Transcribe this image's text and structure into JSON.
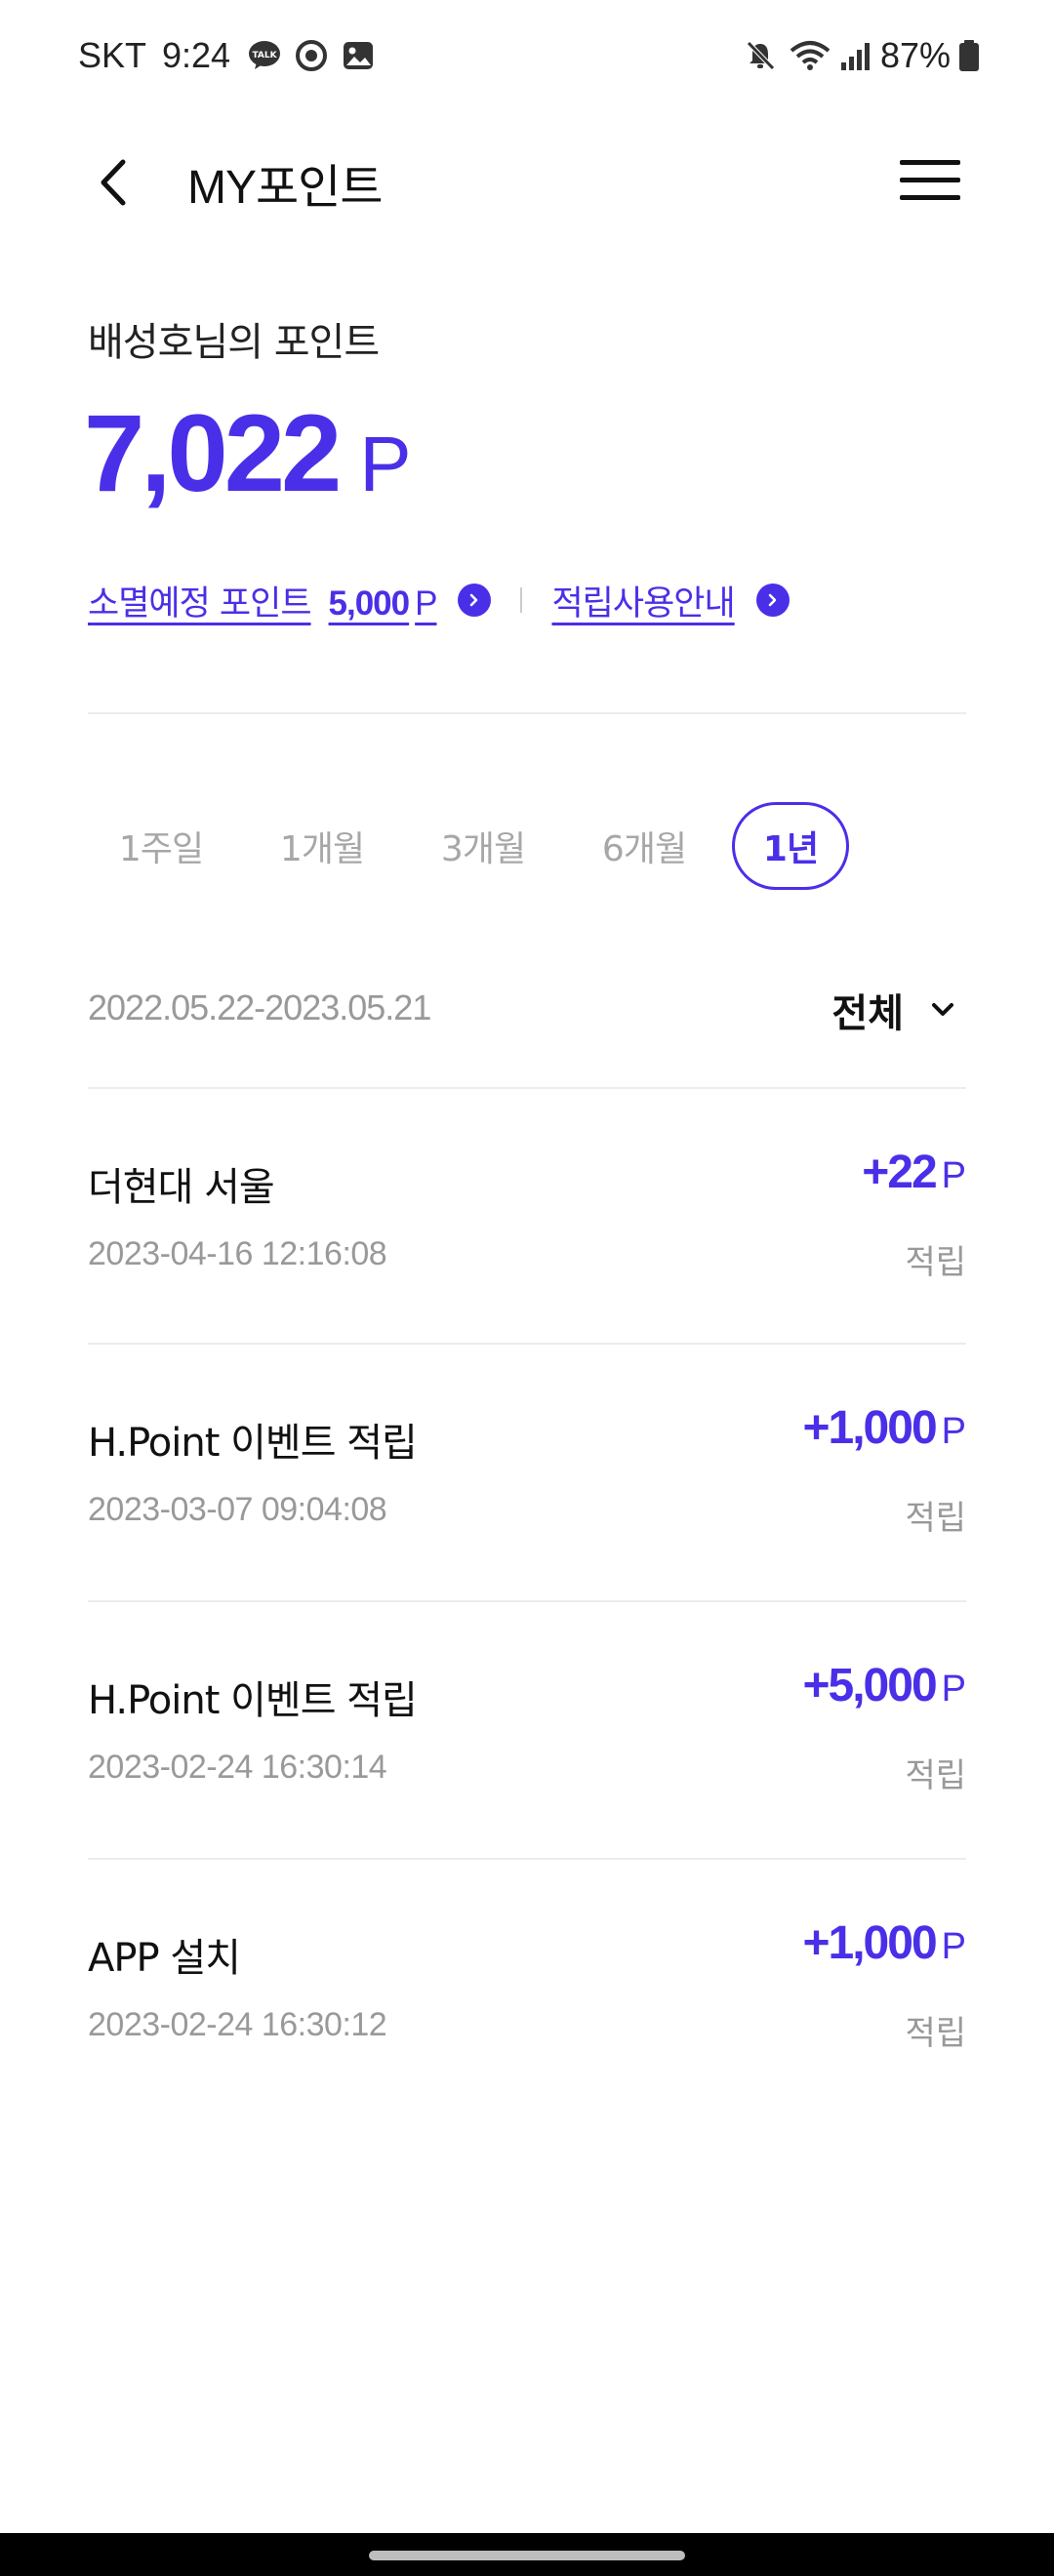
{
  "status_bar": {
    "carrier": "SKT",
    "time": "9:24",
    "battery": "87%",
    "notification_icons": [
      "kakaotalk-icon",
      "target-icon",
      "gallery-icon"
    ],
    "system_icons": [
      "mute-icon",
      "wifi-icon",
      "signal-icon",
      "battery-icon"
    ]
  },
  "header": {
    "title": "MY포인트",
    "back_icon": "back-arrow-icon",
    "menu_icon": "hamburger-menu-icon"
  },
  "summary": {
    "owner_label": "배성호님의 포인트",
    "points": "7,022",
    "points_unit": "P",
    "expiring_label": "소멸예정 포인트",
    "expiring_value": "5,000",
    "expiring_unit": "P",
    "guide_label": "적립사용안내"
  },
  "period_tabs": [
    {
      "label": "1주일",
      "active": false
    },
    {
      "label": "1개월",
      "active": false
    },
    {
      "label": "3개월",
      "active": false
    },
    {
      "label": "6개월",
      "active": false
    },
    {
      "label": "1년",
      "active": true
    }
  ],
  "filter": {
    "date_range": "2022.05.22-2023.05.21",
    "type_label": "전체"
  },
  "transactions": [
    {
      "name": "더현대 서울",
      "date": "2023-04-16 12:16:08",
      "amount": "+22",
      "unit": "P",
      "type": "적립"
    },
    {
      "name": "H.Point 이벤트 적립",
      "date": "2023-03-07 09:04:08",
      "amount": "+1,000",
      "unit": "P",
      "type": "적립"
    },
    {
      "name": "H.Point 이벤트 적립",
      "date": "2023-02-24 16:30:14",
      "amount": "+5,000",
      "unit": "P",
      "type": "적립"
    },
    {
      "name": "APP 설치",
      "date": "2023-02-24 16:30:12",
      "amount": "+1,000",
      "unit": "P",
      "type": "적립"
    }
  ],
  "colors": {
    "accent": "#4a2fe8",
    "text": "#111111",
    "muted": "#999999",
    "divider": "#ececec"
  }
}
